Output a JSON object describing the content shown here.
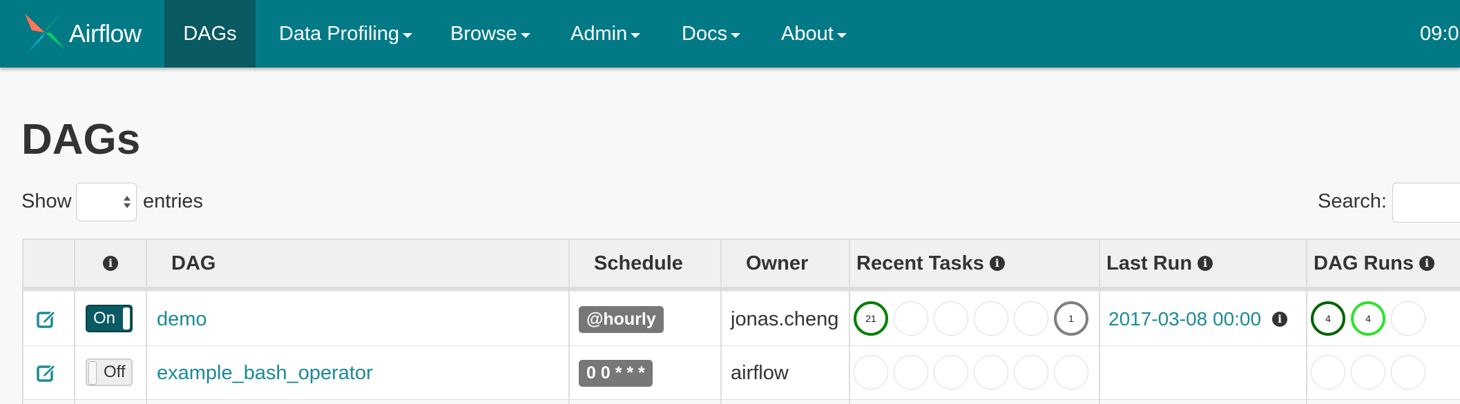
{
  "brand": {
    "name": "Airflow"
  },
  "nav": {
    "items": [
      {
        "label": "DAGs",
        "active": true
      },
      {
        "label": "Data Profiling",
        "dropdown": true
      },
      {
        "label": "Browse",
        "dropdown": true
      },
      {
        "label": "Admin",
        "dropdown": true
      },
      {
        "label": "Docs",
        "dropdown": true
      },
      {
        "label": "About",
        "dropdown": true
      }
    ],
    "clock": "09:0"
  },
  "page": {
    "title": "DAGs",
    "show_label": "Show",
    "entries_label": "entries",
    "search_label": "Search:",
    "search_value": ""
  },
  "table": {
    "headers": {
      "info": "i",
      "dag": "DAG",
      "schedule": "Schedule",
      "owner": "Owner",
      "recent_tasks": "Recent Tasks",
      "last_run": "Last Run",
      "dag_runs": "DAG Runs"
    },
    "rows": [
      {
        "toggle": "On",
        "toggle_state": "on",
        "dag": "demo",
        "schedule": "@hourly",
        "owner": "jonas.cheng",
        "recent_tasks": [
          "21",
          "",
          "",
          "",
          "",
          "1"
        ],
        "last_run": "2017-03-08 00:00",
        "dag_runs": [
          "4",
          "4",
          ""
        ]
      },
      {
        "toggle": "Off",
        "toggle_state": "off",
        "dag": "example_bash_operator",
        "schedule": "0 0 * * *",
        "owner": "airflow",
        "recent_tasks": [
          "",
          "",
          "",
          "",
          "",
          ""
        ],
        "last_run": "",
        "dag_runs": [
          "",
          "",
          ""
        ]
      }
    ]
  },
  "colors": {
    "navbar": "#017a86",
    "nav_active": "#0a5a62",
    "link": "#1a8a96",
    "success": "#008000",
    "running": "#00ff00",
    "neutral": "#808080",
    "badge": "#777777"
  }
}
